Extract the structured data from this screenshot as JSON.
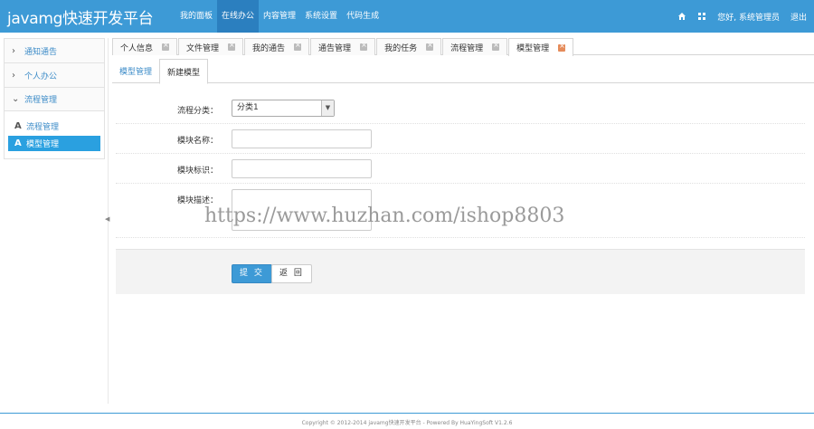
{
  "brand": "javamg快速开发平台",
  "top_nav": [
    {
      "label": "我的面板",
      "active": false
    },
    {
      "label": "在线办公",
      "active": true
    },
    {
      "label": "内容管理",
      "active": false
    },
    {
      "label": "系统设置",
      "active": false
    },
    {
      "label": "代码生成",
      "active": false
    }
  ],
  "top_right": {
    "home_icon": "home-icon",
    "grid_icon": "grid-icon",
    "greeting": "您好, 系统管理员",
    "logout": "退出"
  },
  "sidebar": {
    "items": [
      {
        "label": "通知通告",
        "icon": "chevron-right-icon"
      },
      {
        "label": "个人办公",
        "icon": "chevron-right-icon"
      },
      {
        "label": "流程管理",
        "icon": "chevron-down-icon"
      }
    ],
    "sub_items": [
      {
        "label": "流程管理",
        "active": false
      },
      {
        "label": "模型管理",
        "active": true
      }
    ]
  },
  "tabs": [
    {
      "label": "个人信息",
      "active": false
    },
    {
      "label": "文件管理",
      "active": false
    },
    {
      "label": "我的通告",
      "active": false
    },
    {
      "label": "通告管理",
      "active": false
    },
    {
      "label": "我的任务",
      "active": false
    },
    {
      "label": "流程管理",
      "active": false
    },
    {
      "label": "模型管理",
      "active": true
    }
  ],
  "subtabs": [
    {
      "label": "模型管理",
      "active": false
    },
    {
      "label": "新建模型",
      "active": true
    }
  ],
  "form": {
    "category_label": "流程分类：",
    "category_value": "分类1",
    "name_label": "模块名称：",
    "key_label": "模块标识：",
    "desc_label": "模块描述："
  },
  "buttons": {
    "submit": "提 交",
    "back": "返 回"
  },
  "watermark": "https://www.huzhan.com/ishop8803",
  "footer": "Copyright © 2012-2014 javamg快速开发平台 - Powered By HuaYingSoft V1.2.6",
  "colors": {
    "brand": "#3d9ad6",
    "active_nav": "#2b7fbf",
    "link": "#3d8cc8",
    "active_sub": "#2aa0e0"
  }
}
